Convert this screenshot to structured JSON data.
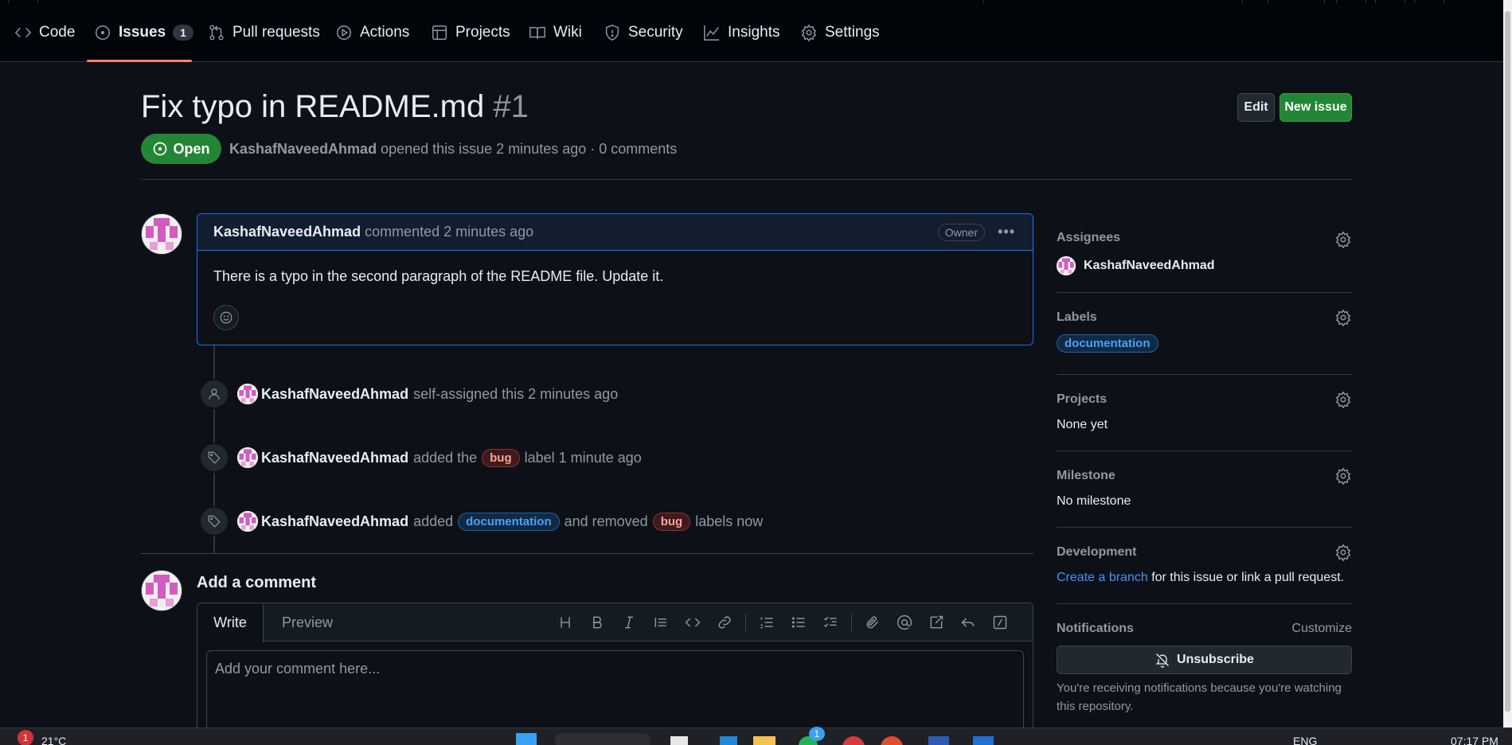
{
  "repo_nav": {
    "tabs": [
      {
        "label": "Code",
        "icon": "code-icon"
      },
      {
        "label": "Issues",
        "icon": "issue-opened-icon",
        "counter": "1",
        "active": true
      },
      {
        "label": "Pull requests",
        "icon": "git-pull-request-icon"
      },
      {
        "label": "Actions",
        "icon": "play-icon"
      },
      {
        "label": "Projects",
        "icon": "table-icon"
      },
      {
        "label": "Wiki",
        "icon": "book-icon"
      },
      {
        "label": "Security",
        "icon": "shield-icon"
      },
      {
        "label": "Insights",
        "icon": "graph-icon"
      },
      {
        "label": "Settings",
        "icon": "gear-icon"
      }
    ]
  },
  "issue": {
    "title": "Fix typo in README.md",
    "number": "#1",
    "edit_label": "Edit",
    "new_issue_label": "New issue",
    "state": "Open",
    "author": "KashafNaveedAhmad",
    "meta_text": "opened this issue 2 minutes ago · 0 comments"
  },
  "comment": {
    "author": "KashafNaveedAhmad",
    "action": "commented 2 minutes ago",
    "role": "Owner",
    "body": "There is a typo in the second paragraph of the README file. Update it."
  },
  "timeline": {
    "events": [
      {
        "user": "KashafNaveedAhmad",
        "text": "self-assigned this 2 minutes ago"
      },
      {
        "user": "KashafNaveedAhmad",
        "pre": "added the",
        "label": "bug",
        "post": "label 1 minute ago"
      },
      {
        "user": "KashafNaveedAhmad",
        "pre": "added",
        "label_add": "documentation",
        "mid": "and removed",
        "label_remove": "bug",
        "post": "labels now"
      }
    ]
  },
  "add_comment": {
    "title": "Add a comment",
    "write_tab": "Write",
    "preview_tab": "Preview",
    "placeholder": "Add your comment here..."
  },
  "sidebar": {
    "assignees": {
      "heading": "Assignees",
      "user": "KashafNaveedAhmad"
    },
    "labels": {
      "heading": "Labels",
      "label": "documentation"
    },
    "projects": {
      "heading": "Projects",
      "value": "None yet"
    },
    "milestone": {
      "heading": "Milestone",
      "value": "No milestone"
    },
    "development": {
      "heading": "Development",
      "link": "Create a branch",
      "text": "for this issue or link a pull request."
    },
    "notifications": {
      "heading": "Notifications",
      "customize": "Customize",
      "unsubscribe": "Unsubscribe",
      "note": "You're receiving notifications because you're watching this repository."
    }
  },
  "taskbar": {
    "weather": "21°C",
    "weather_badge": "1",
    "lang": "ENG",
    "time": "07:17 PM",
    "app_badge": "1"
  },
  "colors": {
    "background": "#0d1117",
    "open_green": "#238636",
    "link_blue": "#4493f8",
    "tab_underline": "#f78166"
  }
}
